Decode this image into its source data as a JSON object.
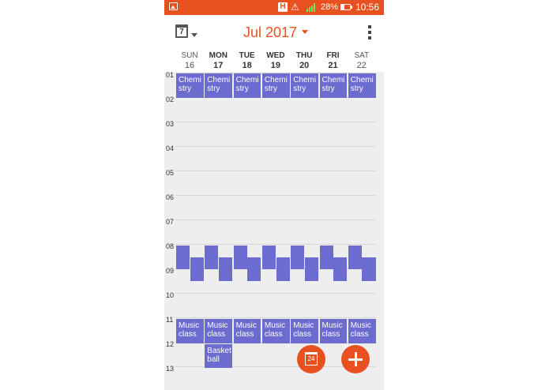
{
  "status_bar": {
    "h_badge": "H",
    "battery_pct": "28%",
    "time": "10:56"
  },
  "app_bar": {
    "today_icon_day": "7",
    "month_title": "Jul 2017"
  },
  "days": [
    {
      "name": "SUN",
      "date": "16"
    },
    {
      "name": "MON",
      "date": "17"
    },
    {
      "name": "TUE",
      "date": "18"
    },
    {
      "name": "WED",
      "date": "19"
    },
    {
      "name": "THU",
      "date": "20"
    },
    {
      "name": "FRI",
      "date": "21"
    },
    {
      "name": "SAT",
      "date": "22"
    }
  ],
  "hours": [
    "01",
    "02",
    "03",
    "04",
    "05",
    "06",
    "07",
    "08",
    "09",
    "10",
    "11",
    "12",
    "13"
  ],
  "events": {
    "chemistry": "Chemi stry",
    "music": "Music class",
    "basketball": "Basket ball"
  },
  "fab": {
    "today_day": "24"
  },
  "colors": {
    "accent": "#e8501f",
    "event": "#6b6bd0",
    "grid_bg": "#eeeeee"
  }
}
